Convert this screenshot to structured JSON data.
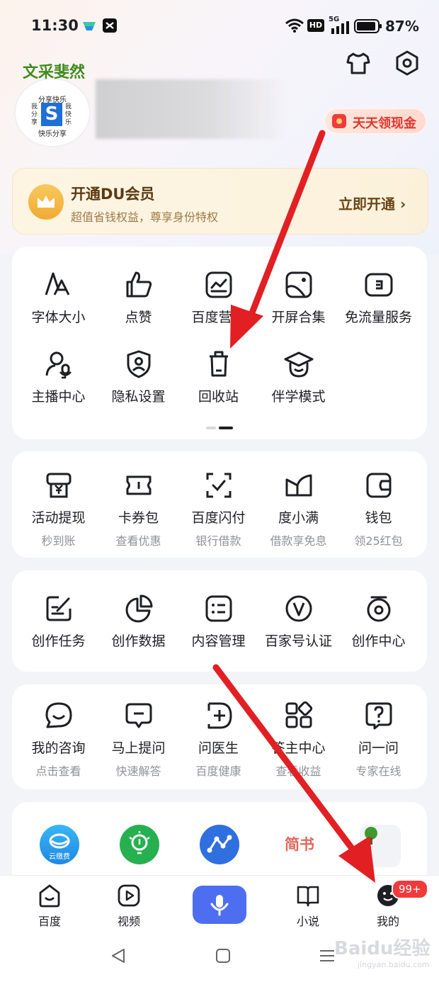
{
  "status_bar": {
    "time": "11:30",
    "hd_label": "HD",
    "network_label": "5G",
    "battery": "87%"
  },
  "profile": {
    "avatar_title": "文采斐然",
    "avatar_line1": "分享快乐",
    "avatar_line2": "快乐分享",
    "avatar_side_left": "我分享",
    "avatar_side_right": "我快乐",
    "avatar_logo_letter": "S",
    "cash_button": "天天领现金"
  },
  "vip": {
    "title": "开通DU会员",
    "subtitle": "超值省钱权益，尊享身份特权",
    "action": "立即开通 ›"
  },
  "tools": {
    "items": [
      {
        "label": "字体大小",
        "icon": "font-size-icon"
      },
      {
        "label": "点赞",
        "icon": "thumbs-up-icon"
      },
      {
        "label": "百度营销",
        "icon": "chart-icon"
      },
      {
        "label": "开屏合集",
        "icon": "image-icon"
      },
      {
        "label": "免流量服务",
        "icon": "sim-card-icon"
      },
      {
        "label": "主播中心",
        "icon": "anchor-icon"
      },
      {
        "label": "隐私设置",
        "icon": "shield-user-icon"
      },
      {
        "label": "回收站",
        "icon": "trash-icon"
      },
      {
        "label": "伴学模式",
        "icon": "graduation-cap-icon"
      }
    ]
  },
  "finance": {
    "items": [
      {
        "label": "活动提现",
        "sub": "秒到账"
      },
      {
        "label": "卡券包",
        "sub": "查看优惠"
      },
      {
        "label": "百度闪付",
        "sub": "银行借款"
      },
      {
        "label": "度小满",
        "sub": "借款享免息"
      },
      {
        "label": "钱包",
        "sub": "领25红包"
      }
    ]
  },
  "creator": {
    "items": [
      {
        "label": "创作任务"
      },
      {
        "label": "创作数据"
      },
      {
        "label": "内容管理"
      },
      {
        "label": "百家号认证"
      },
      {
        "label": "创作中心"
      }
    ]
  },
  "health": {
    "items": [
      {
        "label": "我的咨询",
        "sub": "点击查看"
      },
      {
        "label": "马上提问",
        "sub": "快速解答"
      },
      {
        "label": "问医生",
        "sub": "百度健康"
      },
      {
        "label": "答主中心",
        "sub": "查看收益"
      },
      {
        "label": "问一问",
        "sub": "专家在线"
      }
    ]
  },
  "apps": {
    "yunjiaofei": "云缴费",
    "jianshu": "简书"
  },
  "tabbar": {
    "items": [
      {
        "label": "百度"
      },
      {
        "label": "视频"
      },
      {
        "label": "小说"
      },
      {
        "label": "我的"
      }
    ],
    "badge": "99+"
  },
  "watermark": {
    "main": "Baidu经验",
    "sub": "jingyan.baidu.com"
  },
  "colors": {
    "accent": "#4e6ef2",
    "red": "#f23a3c",
    "arrow": "#e21f23"
  }
}
